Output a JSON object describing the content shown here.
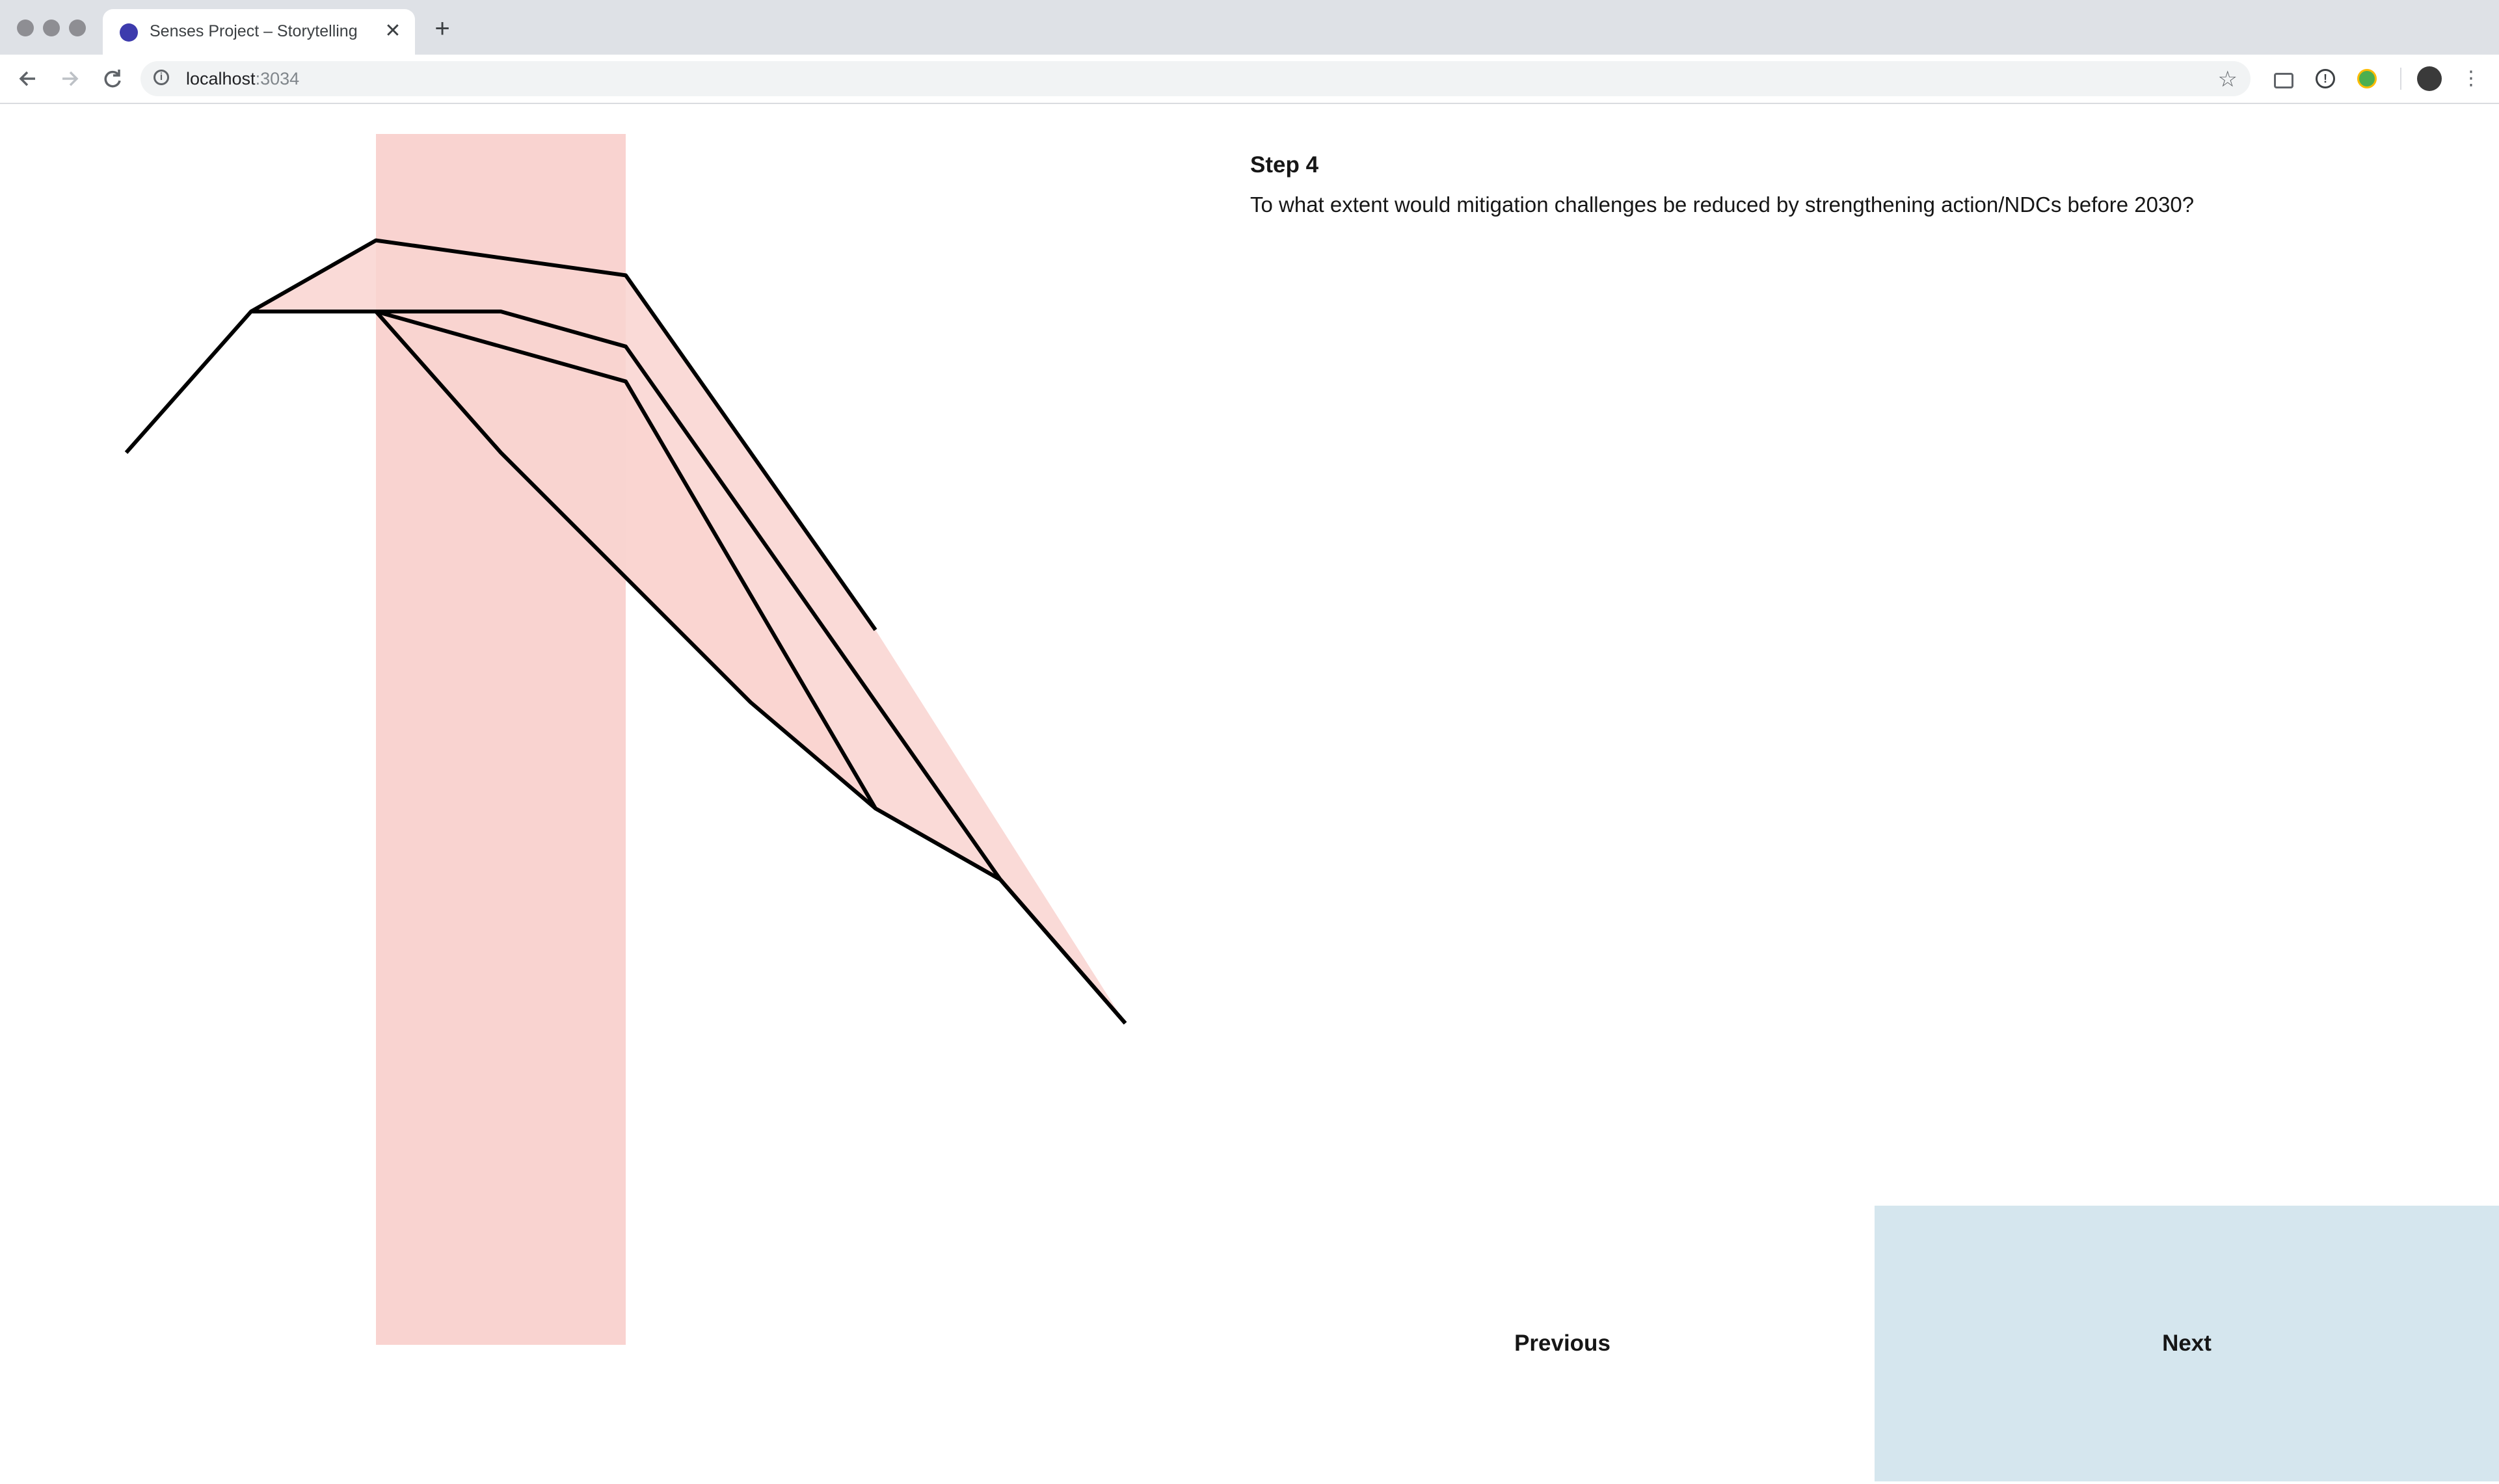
{
  "browser": {
    "tab_title": "Senses Project – Storytelling",
    "tab_close_glyph": "✕",
    "new_tab_glyph": "+",
    "url_host": "localhost",
    "url_port": ":3034",
    "icons": [
      "back-icon",
      "forward-icon",
      "reload-icon",
      "info-icon",
      "star-icon",
      "camera-icon",
      "password-icon",
      "extension-icon",
      "profile-avatar",
      "menu-icon"
    ],
    "favicon_color": "#3d3bad"
  },
  "story": {
    "step_label": "Step 4",
    "question": "To what extent would mitigation challenges be reduced by strengthening action/NDCs before 2030?"
  },
  "navigation": {
    "previous_label": "Previous",
    "next_label": "Next",
    "next_bg": "#d5e6ee"
  },
  "chart_data": {
    "type": "line",
    "x": [
      0,
      1,
      2,
      3,
      4,
      5,
      6,
      7,
      8
    ],
    "highlight_band": {
      "from_x": 2,
      "to_x": 4,
      "color": "#f9d3d0"
    },
    "series": [
      {
        "values": [
          0.0,
          1.13,
          1.13,
          null,
          null,
          null,
          null,
          null,
          null
        ]
      },
      {
        "values": [
          null,
          1.13,
          1.7,
          null,
          1.42,
          null,
          -1.42,
          null,
          null
        ]
      },
      {
        "values": [
          null,
          null,
          1.13,
          1.13,
          0.85,
          -0.57,
          null,
          -3.42,
          -4.57
        ]
      },
      {
        "values": [
          null,
          null,
          1.13,
          null,
          0.57,
          null,
          -2.85,
          -3.42,
          -4.57
        ]
      },
      {
        "values": [
          null,
          null,
          1.13,
          0.0,
          null,
          -2.0,
          -2.85,
          -3.42,
          -4.57
        ]
      }
    ],
    "shaded_ranges_color": "#f9d3d0",
    "line_color": "#000000"
  }
}
